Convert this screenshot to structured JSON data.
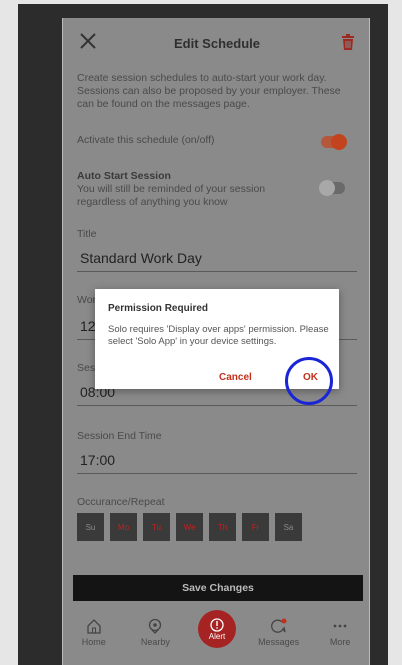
{
  "header": {
    "title": "Edit Schedule"
  },
  "description": "Create session schedules to auto-start your work day. Sessions can also be proposed by your employer. These can be found on the messages page.",
  "activate": {
    "label": "Activate this schedule (on/off)",
    "on": true
  },
  "auto_start": {
    "title": "Auto Start Session",
    "text": "You will still be reminded of your session regardless of anything you know",
    "on": false
  },
  "title_field": {
    "label": "Title",
    "value": "Standard Work Day"
  },
  "work_field": {
    "label": "Wor",
    "value": "12"
  },
  "session_start": {
    "label": "Ses",
    "value": "08:00"
  },
  "session_end": {
    "label": "Session End Time",
    "value": "17:00"
  },
  "repeat": {
    "label": "Occurance/Repeat",
    "days": [
      {
        "label": "Su",
        "active": false
      },
      {
        "label": "Mo",
        "active": true
      },
      {
        "label": "Tu",
        "active": true
      },
      {
        "label": "We",
        "active": true
      },
      {
        "label": "Th",
        "active": true
      },
      {
        "label": "Fr",
        "active": true
      },
      {
        "label": "Sa",
        "active": false
      }
    ]
  },
  "save_label": "Save Changes",
  "tabs": {
    "home": "Home",
    "nearby": "Nearby",
    "alert": "Alert",
    "messages": "Messages",
    "more": "More"
  },
  "dialog": {
    "title": "Permission Required",
    "message": "Solo requires 'Display over apps' permission. Please select 'Solo App' in your device settings.",
    "cancel": "Cancel",
    "ok": "OK"
  },
  "colors": {
    "accent": "#c2301c",
    "highlight_circle": "#1a25d6",
    "day_active_text": "#c71f1f"
  }
}
